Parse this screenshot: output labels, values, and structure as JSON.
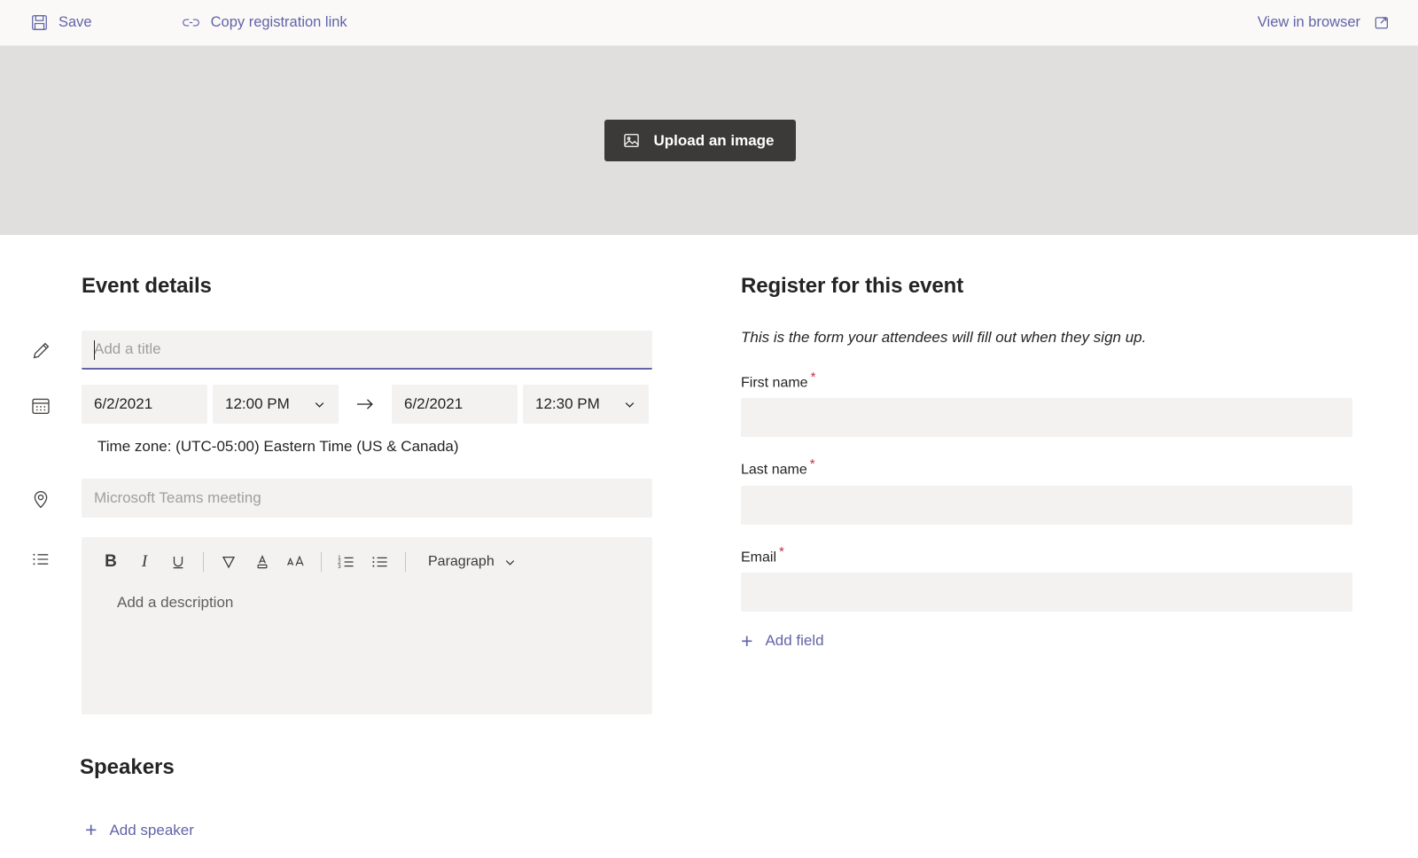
{
  "toolbar": {
    "save_label": "Save",
    "copy_link_label": "Copy registration link",
    "view_in_browser_label": "View in browser",
    "save_icon": "save-floppy-icon",
    "link_icon": "link-icon",
    "open_external_icon": "open-in-new-window-icon",
    "accent_color": "#6264A7"
  },
  "banner": {
    "upload_label": "Upload an image",
    "upload_icon": "image-icon",
    "background_color": "#E1DFDD",
    "button_color": "#3B3A39"
  },
  "event_details": {
    "title": "Event details",
    "title_field": {
      "value": "",
      "placeholder": "Add a title",
      "icon": "pencil-icon",
      "focused": true
    },
    "schedule": {
      "icon": "calendar-icon",
      "start_date": "6/2/2021",
      "start_time": "12:00 PM",
      "end_date": "6/2/2021",
      "end_time": "12:30 PM",
      "arrow": "→",
      "timezone": "Time zone: (UTC-05:00) Eastern Time (US & Canada)"
    },
    "location_field": {
      "value": "",
      "placeholder": "Microsoft Teams meeting",
      "icon": "location-pin-icon"
    },
    "description": {
      "icon": "list-icon",
      "placeholder": "Add a description",
      "toolbar": [
        {
          "name": "bold-button",
          "glyph": "B",
          "label": "Bold"
        },
        {
          "name": "italic-button",
          "glyph": "I",
          "label": "Italic"
        },
        {
          "name": "underline-button",
          "glyph": "U",
          "label": "Underline"
        },
        {
          "name": "highlight-button",
          "glyph": "highlighter-icon",
          "label": "Highlight"
        },
        {
          "name": "font-color-button",
          "glyph": "font-color-icon",
          "label": "Font color"
        },
        {
          "name": "font-size-button",
          "glyph": "font-size-icon",
          "label": "Font size"
        },
        {
          "name": "numbered-list-button",
          "glyph": "numbered-list-icon",
          "label": "Numbered list"
        },
        {
          "name": "bulleted-list-button",
          "glyph": "bulleted-list-icon",
          "label": "Bulleted list"
        }
      ],
      "paragraph_style": "Paragraph"
    }
  },
  "speakers": {
    "title": "Speakers",
    "add_speaker_label": "Add speaker",
    "add_icon": "plus-icon"
  },
  "registration": {
    "title": "Register for this event",
    "note": "This is the form your attendees will fill out when they sign up.",
    "required_marker": "*",
    "required_color": "#C4314B",
    "fields": [
      {
        "label": "First name",
        "required": true,
        "value": ""
      },
      {
        "label": "Last name",
        "required": true,
        "value": ""
      },
      {
        "label": "Email",
        "required": true,
        "value": ""
      }
    ],
    "add_field_label": "Add field",
    "add_icon": "plus-icon"
  }
}
